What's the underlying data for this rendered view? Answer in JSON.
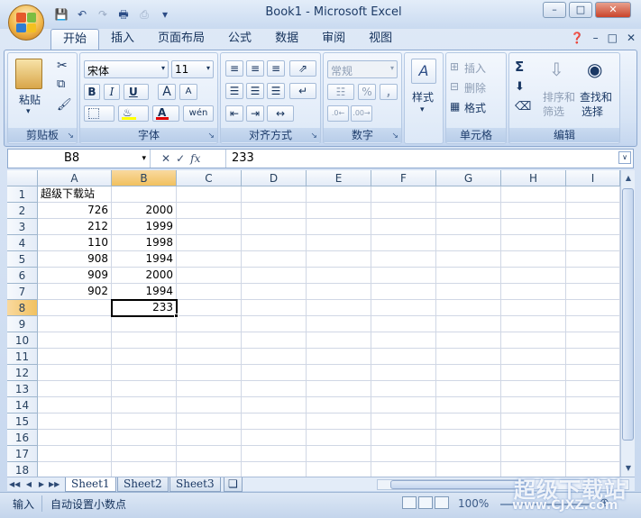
{
  "window": {
    "title": "Book1 - Microsoft Excel"
  },
  "ribbon_tabs": [
    "开始",
    "插入",
    "页面布局",
    "公式",
    "数据",
    "审阅",
    "视图"
  ],
  "clipboard": {
    "paste": "粘贴",
    "label": "剪贴板"
  },
  "font": {
    "name": "宋体",
    "size": "11",
    "label": "字体",
    "bold": "B",
    "italic": "I",
    "underline": "U",
    "grow": "A",
    "shrink": "A",
    "color_glyph": "A",
    "wen": "wén"
  },
  "alignment": {
    "label": "对齐方式"
  },
  "number": {
    "format": "常规",
    "percent": "%",
    "comma": ",",
    "label": "数字"
  },
  "styles": {
    "label": "样式"
  },
  "cells": {
    "insert": "插入",
    "delete": "删除",
    "format": "格式",
    "label": "单元格"
  },
  "editing": {
    "sum": "Σ",
    "sort_line1": "排序和",
    "sort_line2": "筛选",
    "find_line1": "查找和",
    "find_line2": "选择",
    "label": "编辑"
  },
  "formula_bar": {
    "name_box": "B8",
    "fx": "fx",
    "value": "233"
  },
  "columns": [
    "A",
    "B",
    "C",
    "D",
    "E",
    "F",
    "G",
    "H",
    "I"
  ],
  "rows": [
    "1",
    "2",
    "3",
    "4",
    "5",
    "6",
    "7",
    "8",
    "9",
    "10",
    "11",
    "12",
    "13",
    "14",
    "15",
    "16",
    "17",
    "18"
  ],
  "cells_data": {
    "A1": "超级下载站",
    "A2": "726",
    "B2": "2000",
    "A3": "212",
    "B3": "1999",
    "A4": "110",
    "B4": "1998",
    "A5": "908",
    "B5": "1994",
    "A6": "909",
    "B6": "2000",
    "A7": "902",
    "B7": "1994",
    "B8": "233"
  },
  "sheets": [
    "Sheet1",
    "Sheet2",
    "Sheet3"
  ],
  "status": {
    "mode": "输入",
    "fixed_decimal": "自动设置小数点",
    "zoom": "100%"
  },
  "watermark": {
    "line1": "超级下载站",
    "line2": "www.CJXZ.com"
  }
}
